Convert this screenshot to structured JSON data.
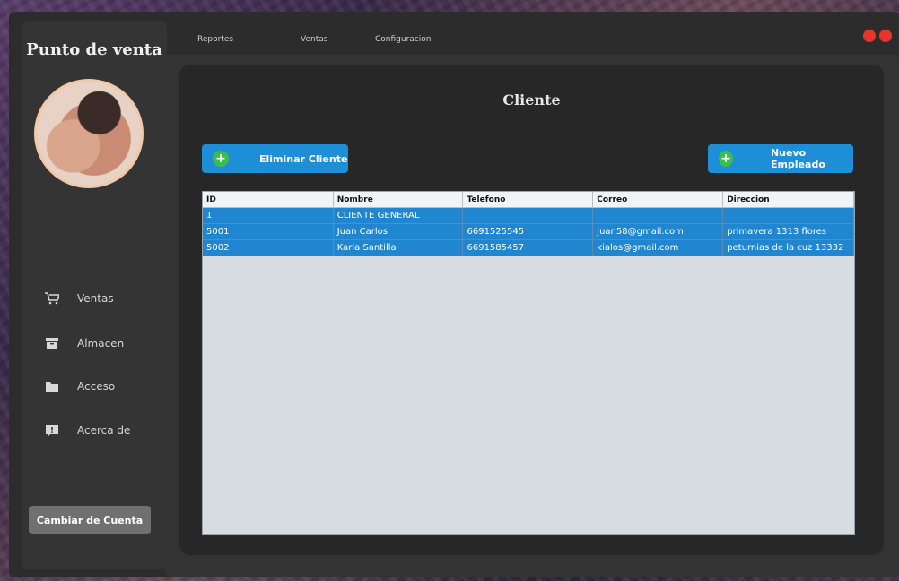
{
  "app": {
    "brand": "Punto de venta"
  },
  "menu": {
    "items": [
      "Reportes",
      "Ventas",
      "Configuracion"
    ]
  },
  "sidebar": {
    "items": [
      {
        "label": "Ventas",
        "icon": "cart-icon"
      },
      {
        "label": "Almacen",
        "icon": "archive-icon"
      },
      {
        "label": "Acceso",
        "icon": "folder-icon"
      },
      {
        "label": "Acerca de",
        "icon": "info-icon"
      }
    ],
    "switch_account": "Cambiar de Cuenta"
  },
  "page": {
    "title": "Cliente",
    "delete_button": "Eliminar Cliente",
    "new_button": "Nuevo Empleado"
  },
  "table": {
    "headers": [
      "ID",
      "Nombre",
      "Telefono",
      "Correo",
      "Direccion"
    ],
    "rows": [
      [
        "1",
        "CLIENTE GENERAL",
        "",
        "",
        ""
      ],
      [
        "5001",
        "Juan Carlos",
        "6691525545",
        "juan58@gmail.com",
        "primavera 1313 flores"
      ],
      [
        "5002",
        "Karla Santilla",
        "6691585457",
        "kialos@gmail.com",
        "peturnias de la cuz 13332"
      ]
    ]
  },
  "colors": {
    "accent": "#1e8fd6",
    "plus": "#3bbf4a",
    "close": "#e8342b"
  }
}
